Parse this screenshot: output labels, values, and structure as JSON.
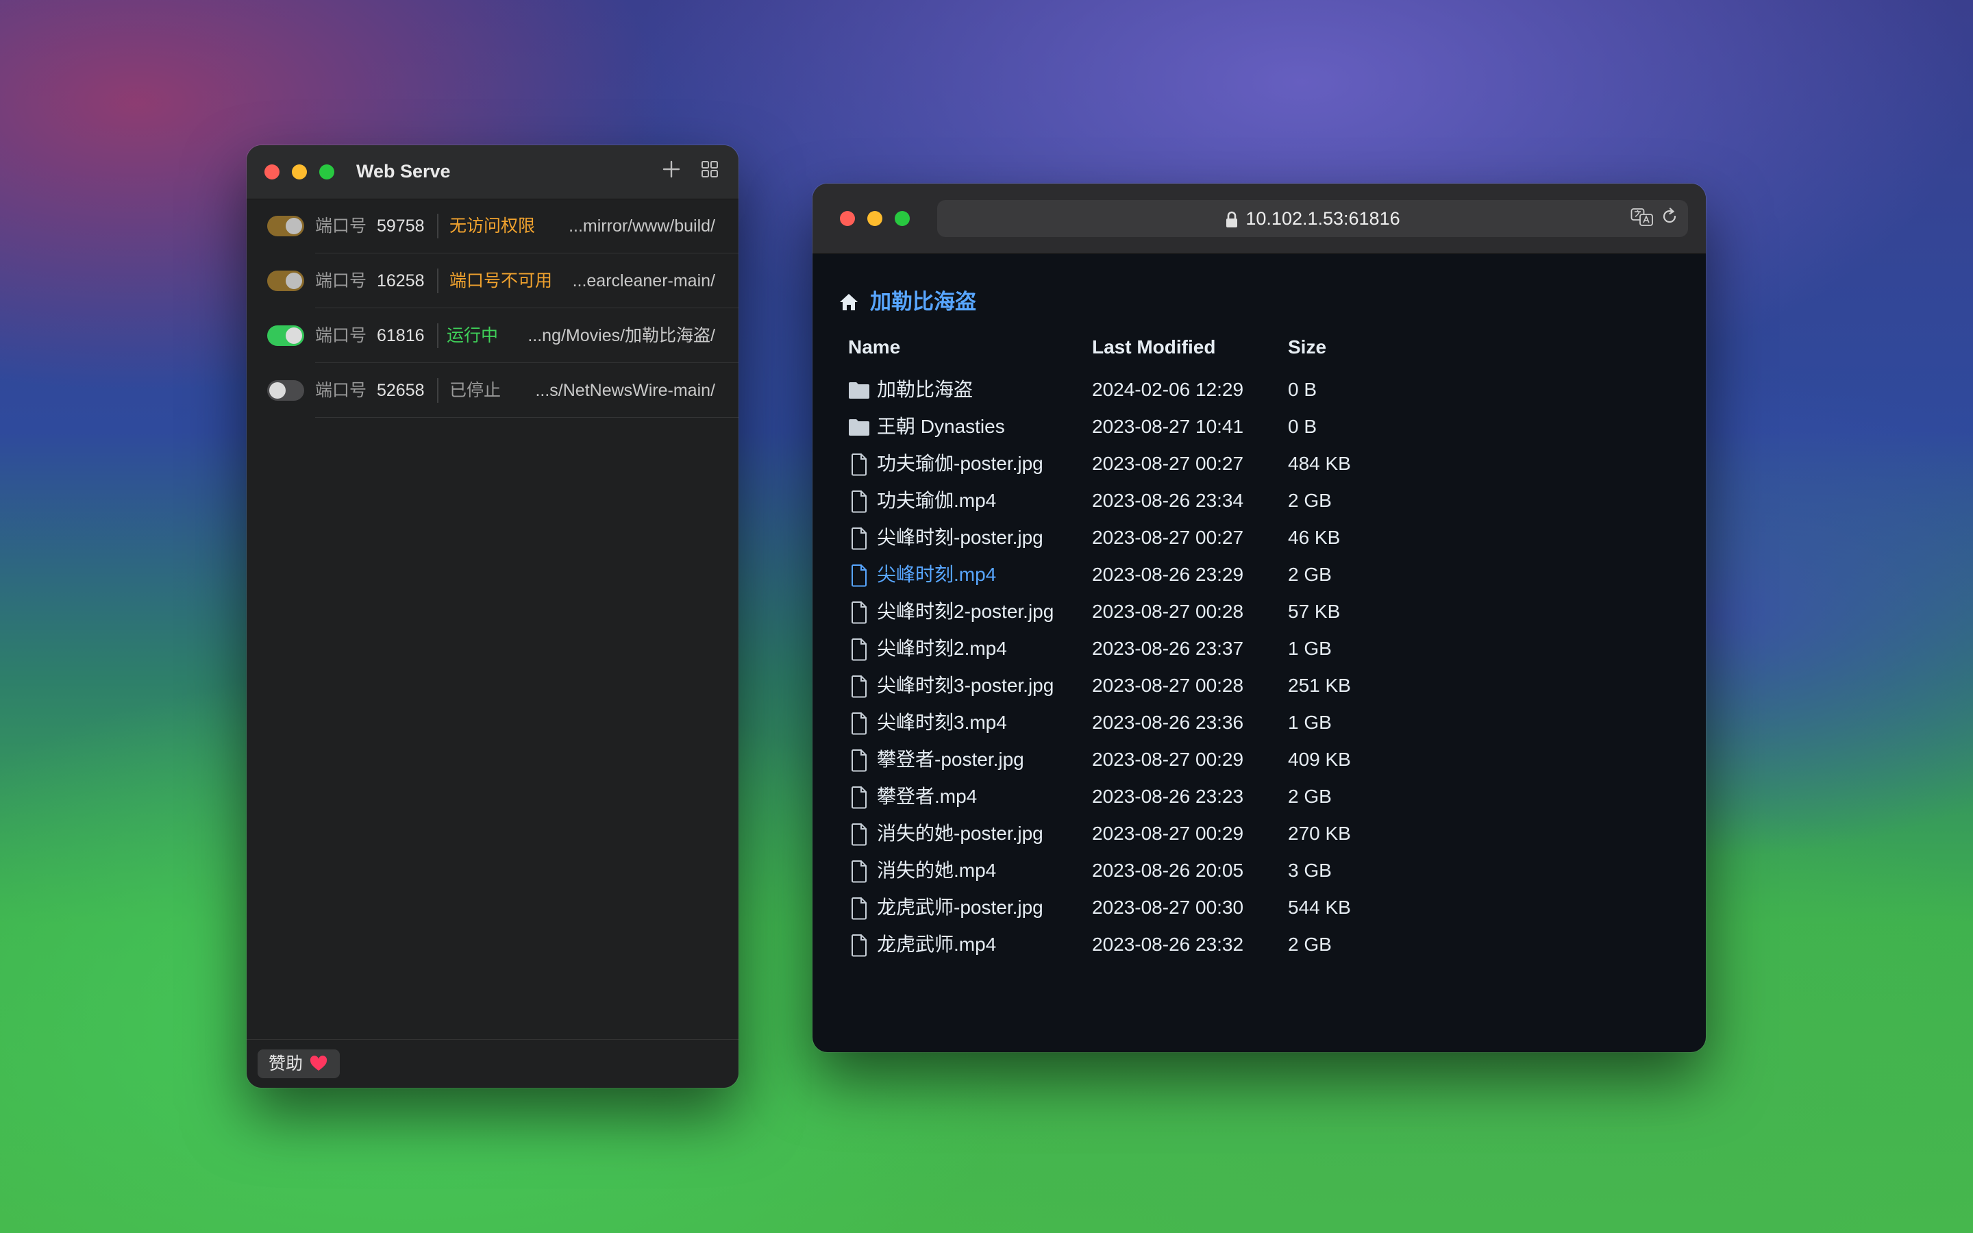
{
  "webserve": {
    "title": "Web Serve",
    "add_icon": "plus-icon",
    "grid_icon": "grid-icon",
    "port_label": "端口号",
    "servers": [
      {
        "enabled": "partial",
        "port": "59758",
        "status": "无访问权限",
        "status_color": "#f0a22e",
        "path": "...mirror/www/build/"
      },
      {
        "enabled": "partial",
        "port": "16258",
        "status": "端口号不可用",
        "status_color": "#f0a22e",
        "path": "...earcleaner-main/"
      },
      {
        "enabled": "on",
        "port": "61816",
        "status": "运行中",
        "status_color": "#3fd159",
        "path": "...ng/Movies/加勒比海盗/"
      },
      {
        "enabled": "off",
        "port": "52658",
        "status": "已停止",
        "status_color": "#9a9a9a",
        "path": "...s/NetNewsWire-main/"
      }
    ],
    "footer": {
      "sponsor_label": "赞助",
      "sponsor_icon": "heart-icon"
    }
  },
  "browser": {
    "url": "10.102.1.53:61816",
    "translate_icon": "translate-icon",
    "reload_icon": "reload-icon",
    "breadcrumb": "加勒比海盗",
    "columns": {
      "name": "Name",
      "modified": "Last Modified",
      "size": "Size"
    },
    "files": [
      {
        "type": "folder",
        "name": "加勒比海盗",
        "modified": "2024-02-06 12:29",
        "size": "0 B"
      },
      {
        "type": "folder",
        "name": "王朝 Dynasties",
        "modified": "2023-08-27 10:41",
        "size": "0 B"
      },
      {
        "type": "file",
        "name": "功夫瑜伽-poster.jpg",
        "modified": "2023-08-27 00:27",
        "size": "484 KB"
      },
      {
        "type": "file",
        "name": "功夫瑜伽.mp4",
        "modified": "2023-08-26 23:34",
        "size": "2 GB"
      },
      {
        "type": "file",
        "name": "尖峰时刻-poster.jpg",
        "modified": "2023-08-27 00:27",
        "size": "46 KB"
      },
      {
        "type": "file",
        "name": "尖峰时刻.mp4",
        "modified": "2023-08-26 23:29",
        "size": "2 GB",
        "hover": true
      },
      {
        "type": "file",
        "name": "尖峰时刻2-poster.jpg",
        "modified": "2023-08-27 00:28",
        "size": "57 KB"
      },
      {
        "type": "file",
        "name": "尖峰时刻2.mp4",
        "modified": "2023-08-26 23:37",
        "size": "1 GB"
      },
      {
        "type": "file",
        "name": "尖峰时刻3-poster.jpg",
        "modified": "2023-08-27 00:28",
        "size": "251 KB"
      },
      {
        "type": "file",
        "name": "尖峰时刻3.mp4",
        "modified": "2023-08-26 23:36",
        "size": "1 GB"
      },
      {
        "type": "file",
        "name": "攀登者-poster.jpg",
        "modified": "2023-08-27 00:29",
        "size": "409 KB"
      },
      {
        "type": "file",
        "name": "攀登者.mp4",
        "modified": "2023-08-26 23:23",
        "size": "2 GB"
      },
      {
        "type": "file",
        "name": "消失的她-poster.jpg",
        "modified": "2023-08-27 00:29",
        "size": "270 KB"
      },
      {
        "type": "file",
        "name": "消失的她.mp4",
        "modified": "2023-08-26 20:05",
        "size": "3 GB"
      },
      {
        "type": "file",
        "name": "龙虎武师-poster.jpg",
        "modified": "2023-08-27 00:30",
        "size": "544 KB"
      },
      {
        "type": "file",
        "name": "龙虎武师.mp4",
        "modified": "2023-08-26 23:32",
        "size": "2 GB"
      }
    ]
  },
  "colors": {
    "link": "#58a6ff",
    "toggle_on": "#34c759",
    "toggle_partial": "#8a6a2a",
    "toggle_off": "#4a4a4c"
  }
}
